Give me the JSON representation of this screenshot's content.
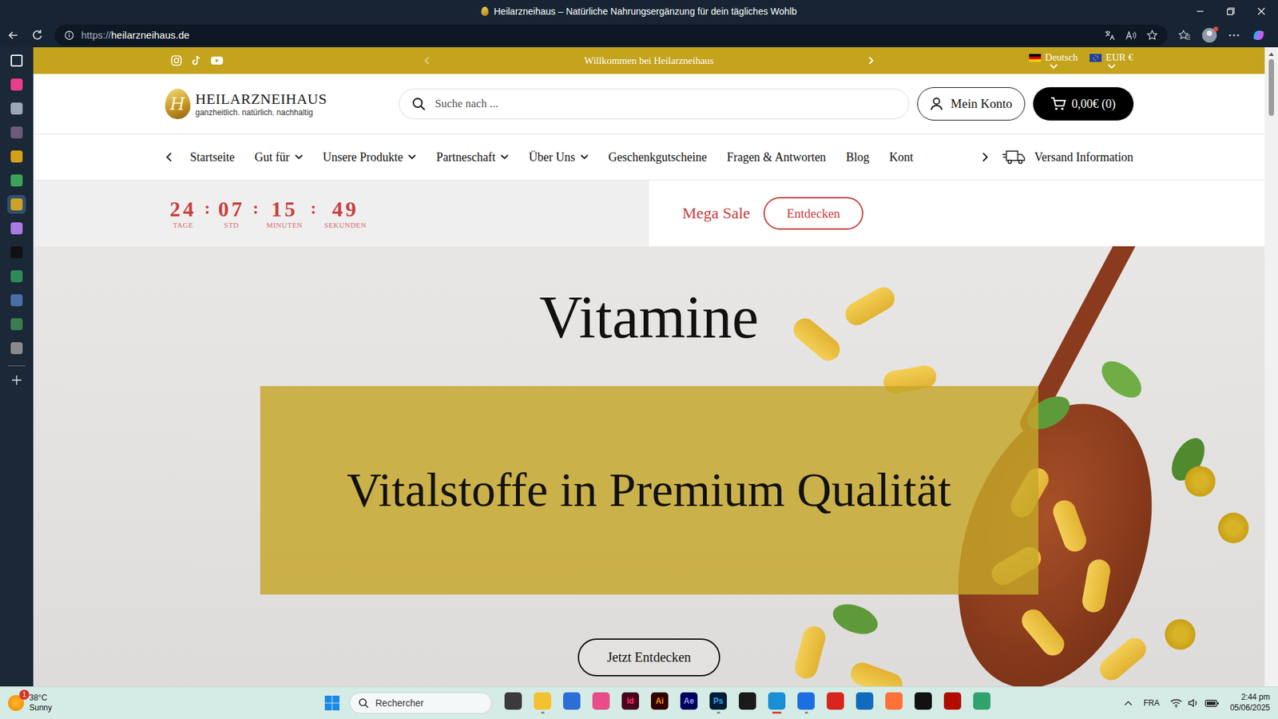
{
  "window": {
    "title": "Heilarzneihaus – Natürliche Nahrungsergänzung für dein tägliches Wohlb"
  },
  "address_bar": {
    "url_prefix": "https://",
    "url_host": "heilarzneihaus.de"
  },
  "edge_sidebar": [
    {
      "kind": "outline",
      "color": "#ffffff",
      "selected": false
    },
    {
      "kind": "tile",
      "color": "#e83e8c",
      "selected": false
    },
    {
      "kind": "tile",
      "color": "#9aa7b8",
      "selected": false
    },
    {
      "kind": "tile",
      "color": "#6b5a7a",
      "selected": false
    },
    {
      "kind": "tile",
      "color": "#d4a017",
      "selected": false
    },
    {
      "kind": "tile",
      "color": "#3aa35a",
      "selected": false
    },
    {
      "kind": "tile",
      "color": "#c9a227",
      "selected": true
    },
    {
      "kind": "tile",
      "color": "#a77be0",
      "selected": false
    },
    {
      "kind": "tile",
      "color": "#111111",
      "selected": false
    },
    {
      "kind": "tile",
      "color": "#2e8b57",
      "selected": false
    },
    {
      "kind": "tile",
      "color": "#4a6fa5",
      "selected": false
    },
    {
      "kind": "tile",
      "color": "#3b7d4f",
      "selected": false
    },
    {
      "kind": "tile",
      "color": "#8a8a8a",
      "selected": false
    }
  ],
  "site": {
    "announcement": "Willkommen bei Heilarzneihaus",
    "language": "Deutsch",
    "currency": "EUR €",
    "logo": {
      "letter": "H",
      "name": "HEILARZNEIHAUS",
      "tagline": "ganzheitlich. natürlich. nachhaltig"
    },
    "search": {
      "placeholder": "Suche nach ..."
    },
    "account": "Mein Konto",
    "cart": "0,00€ (0)",
    "nav": [
      {
        "label": "Startseite",
        "dropdown": false
      },
      {
        "label": "Gut für",
        "dropdown": true
      },
      {
        "label": "Unsere Produkte",
        "dropdown": true
      },
      {
        "label": "Partneschaft",
        "dropdown": true
      },
      {
        "label": "Über Uns",
        "dropdown": true
      },
      {
        "label": "Geschenkgutscheine",
        "dropdown": false
      },
      {
        "label": "Fragen & Antworten",
        "dropdown": false
      },
      {
        "label": "Blog",
        "dropdown": false
      },
      {
        "label": "Kont",
        "dropdown": false
      }
    ],
    "shipping": "Versand Information",
    "countdown_separator": ":",
    "countdown": [
      {
        "value": "24",
        "unit": "TAGE"
      },
      {
        "value": "07",
        "unit": "STD"
      },
      {
        "value": "15",
        "unit": "MINUTEN"
      },
      {
        "value": "49",
        "unit": "SEKUNDEN"
      }
    ],
    "sale": {
      "label": "Mega Sale",
      "button": "Entdecken"
    },
    "hero": {
      "title": "Vitamine",
      "subtitle": "Vitalstoffe in Premium Qualität",
      "button": "Jetzt Entdecken"
    }
  },
  "taskbar": {
    "weather": {
      "temp": "38°C",
      "condition": "Sunny",
      "badge": "1"
    },
    "search": "Rechercher",
    "apps": [
      {
        "color": "#3a3a3a",
        "running": false,
        "active": false
      },
      {
        "color": "#f2c230",
        "running": true,
        "active": false
      },
      {
        "color": "#2b6fd6",
        "running": false,
        "active": false
      },
      {
        "color": "#e84d8a",
        "running": false,
        "active": false
      },
      {
        "color": "#49021f",
        "label": "Id",
        "text_color": "#ff3366",
        "running": false,
        "active": false
      },
      {
        "color": "#330000",
        "label": "Ai",
        "text_color": "#ff9a00",
        "running": false,
        "active": false
      },
      {
        "color": "#00005b",
        "label": "Ae",
        "text_color": "#9999ff",
        "running": false,
        "active": false
      },
      {
        "color": "#001e36",
        "label": "Ps",
        "text_color": "#31a8ff",
        "running": true,
        "active": false
      },
      {
        "color": "#1a1a1a",
        "running": false,
        "active": false
      },
      {
        "color": "#1b8fd6",
        "running": true,
        "active": true
      },
      {
        "color": "#1d6fe0",
        "running": true,
        "active": false
      },
      {
        "color": "#d7261e",
        "running": false,
        "active": false
      },
      {
        "color": "#0f6cbd",
        "running": false,
        "active": false
      },
      {
        "color": "#ff7139",
        "running": false,
        "active": false
      },
      {
        "color": "#111111",
        "running": false,
        "active": false
      },
      {
        "color": "#b30b00",
        "running": false,
        "active": false
      },
      {
        "color": "#2fa36b",
        "running": false,
        "active": false
      }
    ],
    "language": "FRA",
    "time": "2:44 pm",
    "date": "05/06/2025"
  }
}
